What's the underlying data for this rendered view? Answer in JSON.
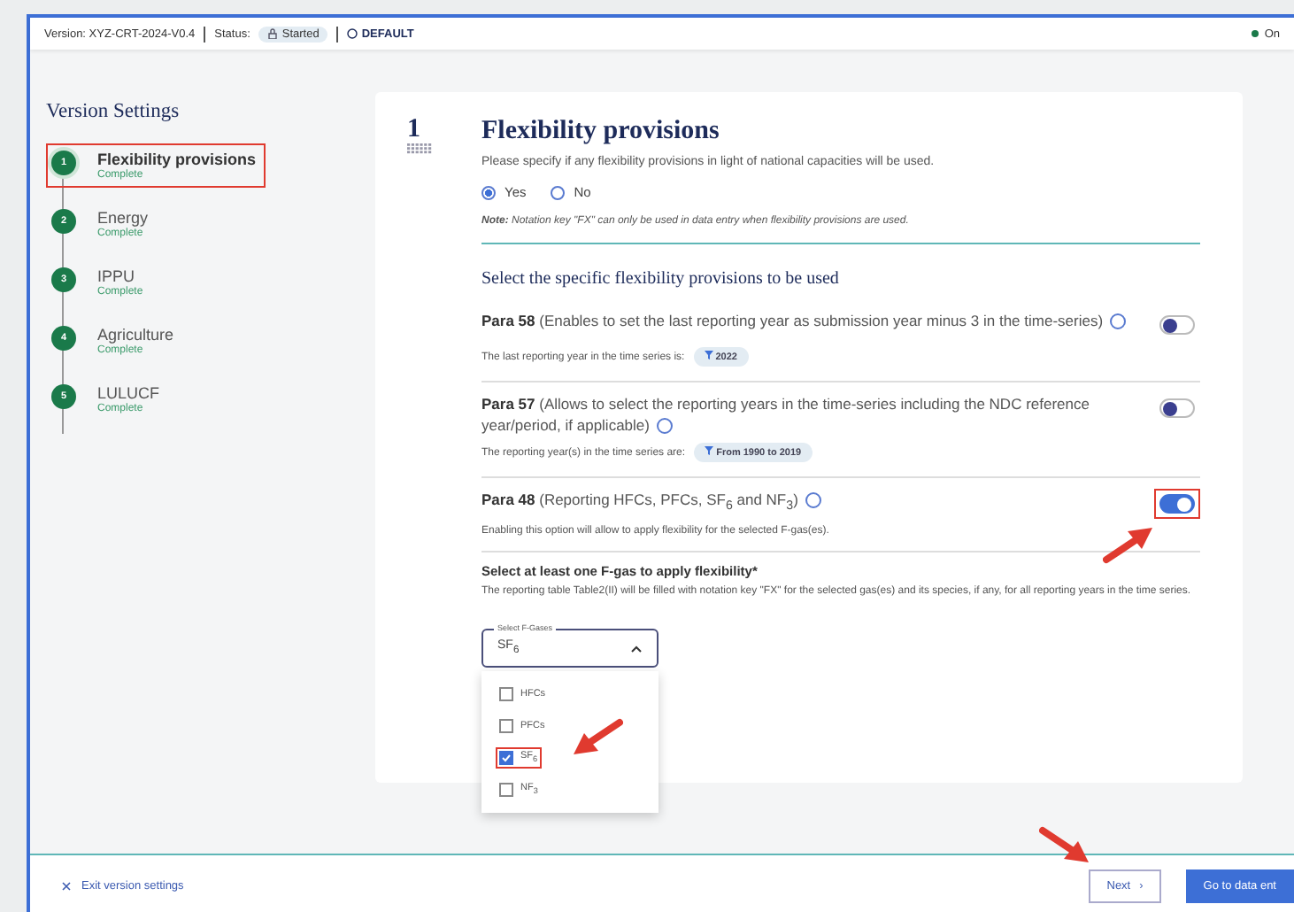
{
  "top_bar": {
    "version_label": "Version: XYZ-CRT-2024-V0.4",
    "status_label": "Status:",
    "status": "Started",
    "mode": "DEFAULT",
    "right_text": "On"
  },
  "page_title": "Version Settings",
  "steps": [
    {
      "number": "1",
      "title": "Flexibility provisions",
      "status": "Complete",
      "selected": true,
      "highlighted": true
    },
    {
      "number": "2",
      "title": "Energy",
      "status": "Complete",
      "selected": false,
      "highlighted": false
    },
    {
      "number": "3",
      "title": "IPPU",
      "status": "Complete",
      "selected": false,
      "highlighted": false
    },
    {
      "number": "4",
      "title": "Agriculture",
      "status": "Complete",
      "selected": false,
      "highlighted": false
    },
    {
      "number": "5",
      "title": "LULUCF",
      "status": "Complete",
      "selected": false,
      "highlighted": false
    }
  ],
  "section": {
    "number": "1",
    "title": "Flexibility provisions",
    "question": "Please specify if any flexibility provisions in light of national capacities will be used.",
    "options": [
      {
        "label": "Yes",
        "selected": true
      },
      {
        "label": "No",
        "selected": false
      }
    ],
    "note": "**Note:** Notation key \"FX\" can only be used in data entry when flexibility provisions are used.",
    "subtitle": "Select the specific flexibility provisions to be used",
    "provisions": [
      {
        "title": "**Para 58** (Enables to set the last reporting year as submission year minus 3 in the time-series)",
        "on": false,
        "highlighted": false,
        "arrow": false,
        "info_label": "The last reporting year in the time series is:",
        "tag": "2022"
      },
      {
        "title": "**Para 57** (Allows to select the reporting years in the time-series including the NDC reference year/period, if applicable)",
        "on": false,
        "highlighted": false,
        "arrow": false,
        "info_label": "The reporting year(s) in the time series are:",
        "tag": "From 1990 to 2019"
      },
      {
        "title": "**Para 48** (Reporting HFCs, PFCs, SF$_{6}$ and NF$_{3}$)",
        "on": true,
        "highlighted": true,
        "arrow": true,
        "info_label": "Enabling this option will allow to apply flexibility for the selected F-gas(es)."
      }
    ],
    "gas_heading": "Select at least one F-gas to apply flexibility*",
    "gas_description": "The reporting table Table2(II) will be filled with notation key \"FX\" for the selected gas(es) and its species, if any, for all reporting years in the time series.",
    "gas_select": {
      "label": "Select F-Gases",
      "value": "SF$_{6}$",
      "expanded": true,
      "options": [
        {
          "label": "HFCs",
          "checked": false,
          "highlighted": false,
          "arrow": false
        },
        {
          "label": "PFCs",
          "checked": false,
          "highlighted": false,
          "arrow": false
        },
        {
          "label": "SF$_{6}$",
          "checked": true,
          "highlighted": true,
          "arrow": true
        },
        {
          "label": "NF$_{3}$",
          "checked": false,
          "highlighted": false,
          "arrow": false
        }
      ]
    }
  },
  "footer": {
    "exit": "Exit version settings",
    "next": "Next",
    "next_icon": "›",
    "next_arrow": true,
    "primary": "Go to data ent"
  }
}
